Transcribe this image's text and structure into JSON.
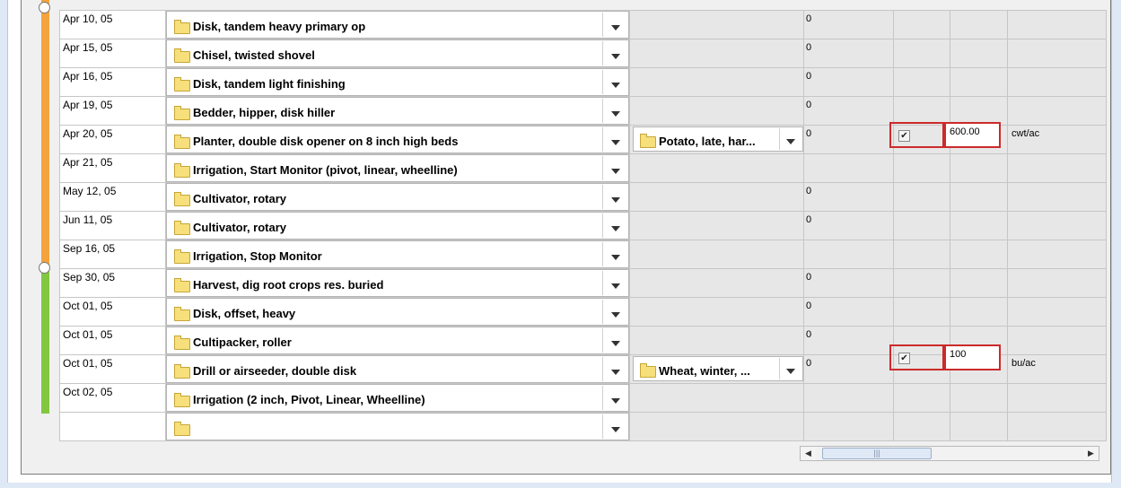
{
  "rows": [
    {
      "date": "Apr 10, 05",
      "operation": "Disk, tandem heavy primary op",
      "crop": "",
      "value": "0",
      "checked": false,
      "yield": "",
      "unit": ""
    },
    {
      "date": "Apr 15, 05",
      "operation": "Chisel, twisted shovel",
      "crop": "",
      "value": "0",
      "checked": false,
      "yield": "",
      "unit": ""
    },
    {
      "date": "Apr 16, 05",
      "operation": "Disk, tandem light finishing",
      "crop": "",
      "value": "0",
      "checked": false,
      "yield": "",
      "unit": ""
    },
    {
      "date": "Apr 19, 05",
      "operation": "Bedder, hipper, disk hiller",
      "crop": "",
      "value": "0",
      "checked": false,
      "yield": "",
      "unit": ""
    },
    {
      "date": "Apr 20, 05",
      "operation": "Planter, double disk opener on 8 inch high beds",
      "crop": "Potato, late, har...",
      "value": "0",
      "checked": true,
      "yield": "600.00",
      "unit": "cwt/ac"
    },
    {
      "date": "Apr 21, 05",
      "operation": "Irrigation, Start Monitor (pivot, linear, wheelline)",
      "crop": "",
      "value": "",
      "checked": false,
      "yield": "",
      "unit": ""
    },
    {
      "date": "May 12, 05",
      "operation": "Cultivator, rotary",
      "crop": "",
      "value": "0",
      "checked": false,
      "yield": "",
      "unit": ""
    },
    {
      "date": "Jun 11, 05",
      "operation": "Cultivator, rotary",
      "crop": "",
      "value": "0",
      "checked": false,
      "yield": "",
      "unit": ""
    },
    {
      "date": "Sep 16, 05",
      "operation": "Irrigation, Stop Monitor",
      "crop": "",
      "value": "",
      "checked": false,
      "yield": "",
      "unit": ""
    },
    {
      "date": "Sep 30, 05",
      "operation": "Harvest, dig root crops res. buried",
      "crop": "",
      "value": "0",
      "checked": false,
      "yield": "",
      "unit": ""
    },
    {
      "date": "Oct 01, 05",
      "operation": "Disk, offset, heavy",
      "crop": "",
      "value": "0",
      "checked": false,
      "yield": "",
      "unit": ""
    },
    {
      "date": "Oct 01, 05",
      "operation": "Cultipacker, roller",
      "crop": "",
      "value": "0",
      "checked": false,
      "yield": "",
      "unit": ""
    },
    {
      "date": "Oct 01, 05",
      "operation": "Drill or airseeder, double disk",
      "crop": "Wheat, winter, ...",
      "value": "0",
      "checked": true,
      "yield": "100",
      "unit": "bu/ac"
    },
    {
      "date": "Oct 02, 05",
      "operation": "Irrigation (2 inch, Pivot, Linear, Wheelline)",
      "crop": "",
      "value": "",
      "checked": false,
      "yield": "",
      "unit": ""
    },
    {
      "date": "",
      "operation": "",
      "crop": "",
      "value": "",
      "checked": false,
      "yield": "",
      "unit": ""
    }
  ],
  "checkmark": "✔",
  "scroll_left": "◀",
  "scroll_right": "▶",
  "scroll_grip": "|||",
  "colors": {
    "season1": "#f5a33c",
    "season2": "#83c63f",
    "highlight": "#cc2a2a"
  }
}
